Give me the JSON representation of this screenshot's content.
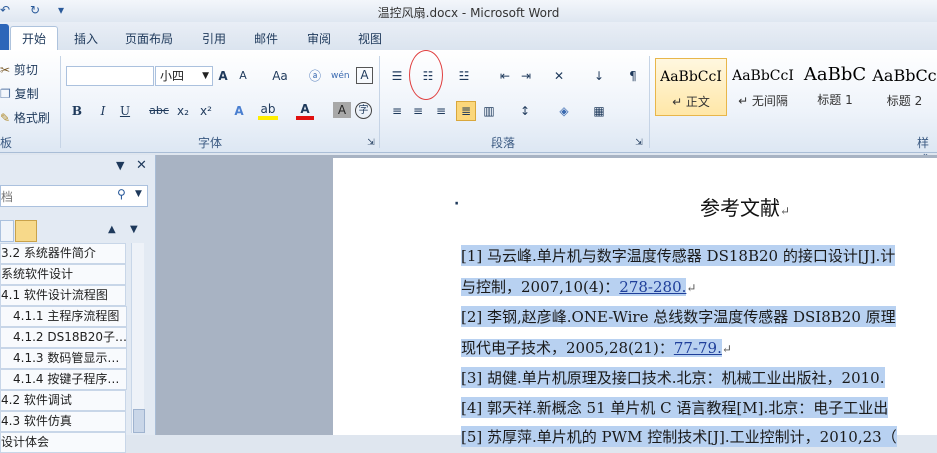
{
  "window": {
    "title": "温控风扇.docx - Microsoft Word"
  },
  "qat": {
    "undo": "↶",
    "redo": "↻",
    "customize": "▾"
  },
  "tabs": [
    "开始",
    "插入",
    "页面布局",
    "引用",
    "邮件",
    "审阅",
    "视图"
  ],
  "clipboard": {
    "cut": "剪切",
    "copy": "复制",
    "format_painter": "格式刷",
    "group_label": "板"
  },
  "font": {
    "size": "小四",
    "grow": "A",
    "shrink": "A",
    "change_case": "Aa",
    "bold": "B",
    "italic": "I",
    "underline": "U",
    "strike": "abc",
    "subscript": "x₂",
    "superscript": "x²",
    "highlight": "ab",
    "font_color": "A",
    "char_shade": "A",
    "enclose": "字",
    "group_label": "字体"
  },
  "paragraph": {
    "group_label": "段落"
  },
  "styles": [
    {
      "sample": "AaBbCcI",
      "name": "↵ 正文"
    },
    {
      "sample": "AaBbCcI",
      "name": "↵ 无间隔"
    },
    {
      "sample": "AaBbC",
      "name": "标题 1"
    },
    {
      "sample": "AaBbCc",
      "name": "标题 2"
    }
  ],
  "styles_group_label": "样式",
  "nav": {
    "search_placeholder": "档",
    "items": [
      "3.2 系统器件简介",
      "系统软件设计",
      "4.1 软件设计流程图",
      "4.1.1 主程序流程图",
      "4.1.2 DS18B20子…",
      "4.1.3 数码管显示…",
      "4.1.4 按键子程序…",
      "4.2 软件调试",
      "4.3 软件仿真",
      "设计体会"
    ]
  },
  "document": {
    "heading": "参考文献",
    "lines": [
      {
        "pre": "[1] 马云峰.单片机与数字温度传感器 DS18B20 的接口设计[J].计",
        "link": ""
      },
      {
        "pre": "与控制，2007,10(4)：",
        "link": "278-280."
      },
      {
        "pre": "[2] 李钢,赵彦峰.ONE-Wire 总线数字温度传感器 DSI8B20 原理",
        "link": ""
      },
      {
        "pre": "现代电子技术，2005,28(21)：",
        "link": "77-79."
      },
      {
        "pre": "[3] 胡健.单片机原理及接口技术.北京：机械工业出版社，2010.",
        "link": ""
      },
      {
        "pre": "[4] 郭天祥.新概念 51 单片机 C 语言教程[M].北京：电子工业出",
        "link": ""
      },
      {
        "pre": "[5] 苏厚萍.单片机的 PWM 控制技术[J].工业控制计，2010,23（",
        "link": ""
      }
    ]
  }
}
